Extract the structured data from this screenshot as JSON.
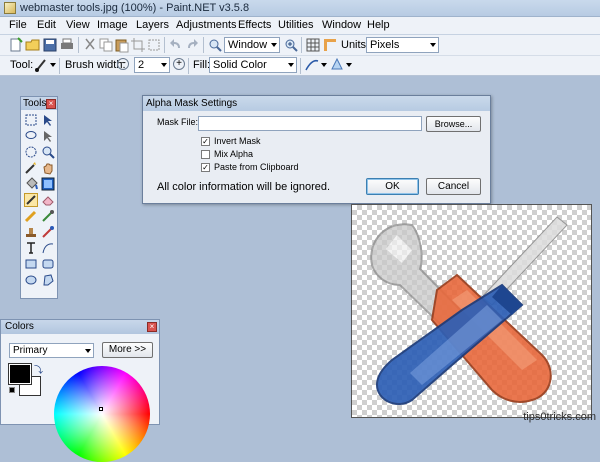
{
  "app": {
    "title": "webmaster tools.jpg (100%) - Paint.NET v3.5.8"
  },
  "menu": [
    "File",
    "Edit",
    "View",
    "Image",
    "Layers",
    "Adjustments",
    "Effects",
    "Utilities",
    "Window",
    "Help"
  ],
  "toolbar": {
    "window_combo": "Window",
    "units_label": "Units:",
    "units_value": "Pixels",
    "tool_label": "Tool:",
    "brush_label": "Brush width:",
    "brush_value": "2",
    "fill_label": "Fill:",
    "fill_value": "Solid Color"
  },
  "tools_panel": {
    "title": "Tools"
  },
  "colors_panel": {
    "title": "Colors",
    "primary_value": "Primary",
    "more_button": "More >>"
  },
  "dialog": {
    "title": "Alpha Mask Settings",
    "mask_label": "Mask File:",
    "mask_value": "",
    "browse_button": "Browse...",
    "invert_label": "Invert Mask",
    "invert_checked": true,
    "mix_label": "Mix Alpha",
    "mix_checked": false,
    "paste_label": "Paste from Clipboard",
    "paste_checked": true,
    "info_text": "All color information will be ignored.",
    "ok_button": "OK",
    "cancel_button": "Cancel"
  },
  "watermark": "tips0tricks.com",
  "colors": {
    "accent": "#2e63b8",
    "handle_red": "#e8693c",
    "handle_blue": "#2d5fb5"
  }
}
